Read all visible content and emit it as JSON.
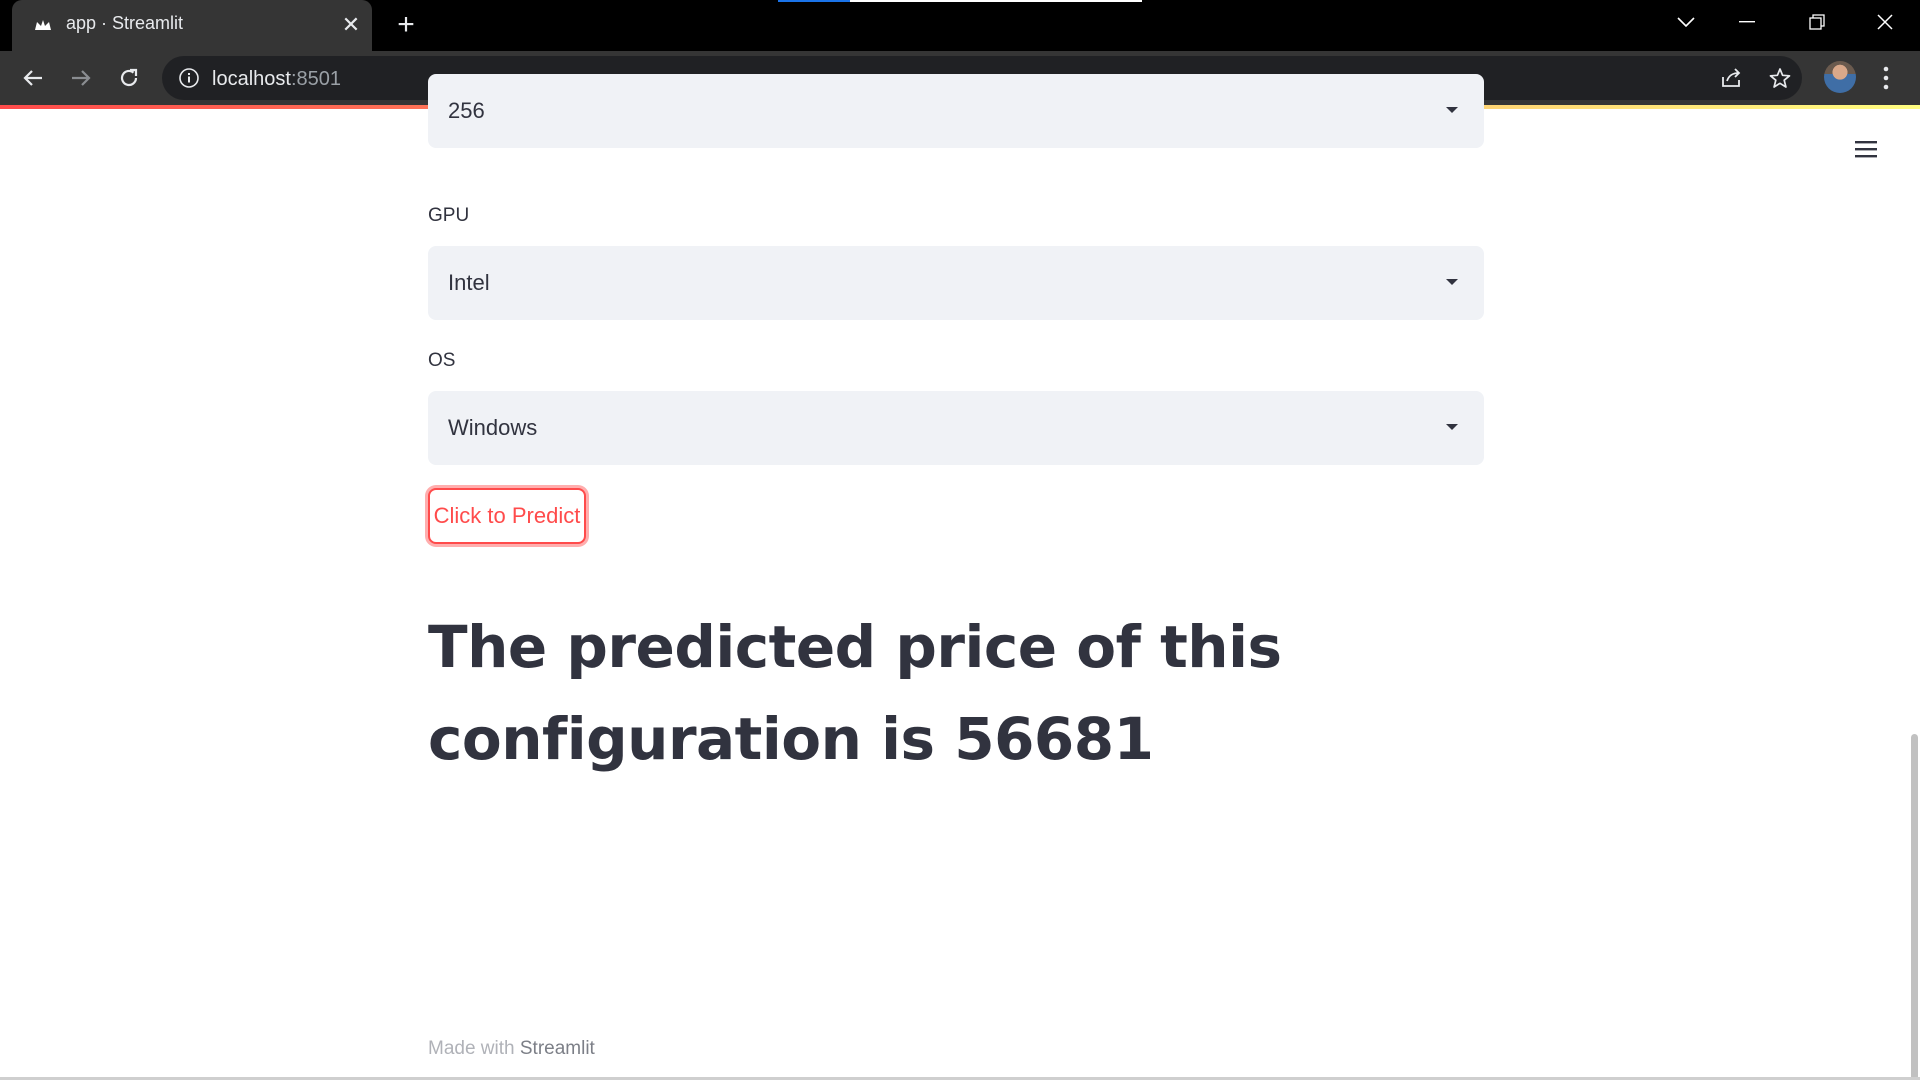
{
  "browser": {
    "tab_title": "app · Streamlit",
    "url_host": "localhost",
    "url_port": ":8501"
  },
  "form": {
    "first_select_value": "256",
    "gpu_label": "GPU",
    "gpu_value": "Intel",
    "os_label": "OS",
    "os_value": "Windows",
    "predict_button": "Click to Predict"
  },
  "result": {
    "heading": "The predicted price of this configuration is 56681"
  },
  "footer": {
    "prefix": "Made with ",
    "brand": "Streamlit"
  },
  "colors": {
    "accent": "#ff4b4b",
    "text": "#31333f",
    "select_bg": "#f0f2f6"
  }
}
